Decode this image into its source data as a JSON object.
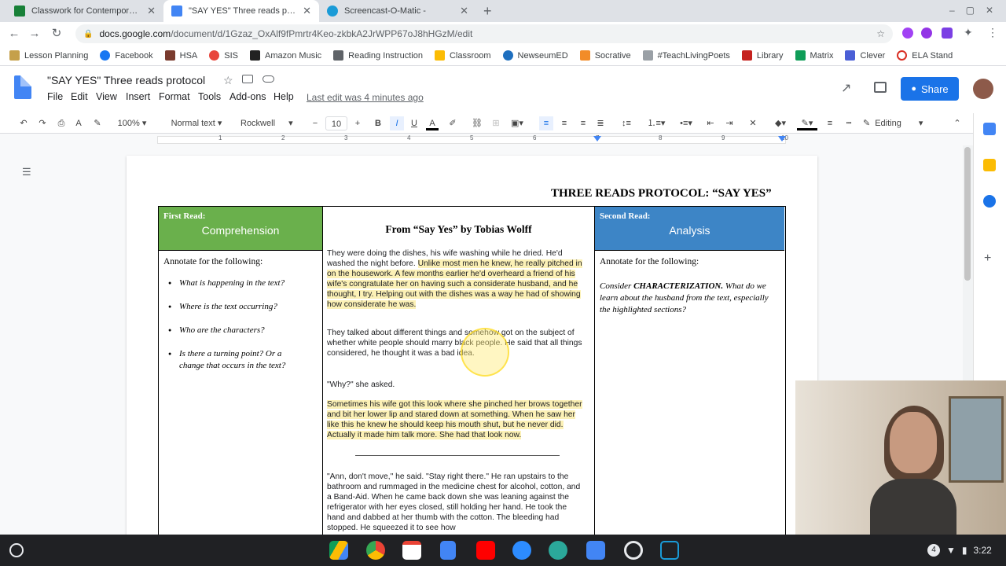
{
  "browser": {
    "tabs": [
      {
        "title": "Classwork for Contemporary Lite",
        "active": false
      },
      {
        "title": "\"SAY YES\" Three reads protocol",
        "active": true
      },
      {
        "title": "Screencast-O-Matic -",
        "active": false
      }
    ],
    "new_tab": "+",
    "url_host": "docs.google.com",
    "url_path": "/document/d/1Gzaz_OxAlf9fPmrtr4Keo-zkbkA2JrWPP67oJ8hHGzM/edit",
    "bookmarks": [
      "Lesson Planning",
      "Facebook",
      "HSA",
      "SIS",
      "Amazon Music",
      "Reading Instruction",
      "Classroom",
      "NewseumED",
      "Socrative",
      "#TeachLivingPoets",
      "Library",
      "Matrix",
      "Clever",
      "ELA Stand"
    ]
  },
  "docs": {
    "title": "\"SAY YES\" Three reads protocol",
    "menus": [
      "File",
      "Edit",
      "View",
      "Insert",
      "Format",
      "Tools",
      "Add-ons",
      "Help"
    ],
    "last_edit": "Last edit was 4 minutes ago",
    "share": "Share"
  },
  "toolbar": {
    "zoom": "100%",
    "style": "Normal text",
    "font": "Rockwell",
    "size": "10",
    "mode": "Editing"
  },
  "ruler_numbers": [
    "1",
    "2",
    "3",
    "4",
    "5",
    "6",
    "7",
    "8",
    "9",
    "10"
  ],
  "document": {
    "heading": "THREE READS PROTOCOL: “SAY YES”",
    "col1": {
      "small": "First Read:",
      "big": "Comprehension",
      "annotate": "Annotate for the following:",
      "bullets": [
        "What is happening in the text?",
        "Where is the text occurring?",
        "Who are the characters?",
        "Is there a turning point? Or a change that occurs in the text?"
      ]
    },
    "col2": {
      "title": "From “Say Yes” by Tobias Wolff",
      "p1_plain": "They were doing the dishes, his wife washing while he dried. He'd washed the night before. ",
      "p1_hl": "Unlike most men he knew, he really pitched in on the housework. A few months earlier he'd overheard a friend of his wife's congratulate her on having such a considerate husband, and he thought, I try.  Helping out with the dishes was a way he had of showing how considerate he was.",
      "p2": "They talked about different things and somehow got on the subject of whether white people should marry black people. He said that all things considered, he thought it was a bad idea.",
      "p3": "\"Why?\" she asked.",
      "p4": "Sometimes his wife got this look where she pinched her brows together and bit her lower lip and stared down at something. When he saw her like this he knew he should keep his mouth shut, but he never did. Actually it made him talk more. She had that look now.",
      "p5": "\"Ann, don't move,\" he said. \"Stay right there.\" He ran upstairs to the bathroom and rummaged in  the medicine chest for alcohol, cotton, and a Band-Aid. When he came back down she was leaning against the refrigerator with her eyes closed, still holding her hand. He took the hand and  dabbed at her thumb with the cotton. The bleeding had stopped. He squeezed it to see how"
    },
    "col3": {
      "small": "Second Read:",
      "big": "Analysis",
      "annotate": "Annotate for the following:",
      "consider_a": "Consider ",
      "consider_b": "CHARACTERIZATION.",
      "consider_c": " What do we learn about the husband from the text, especially the highlighted sections?"
    }
  },
  "shelf": {
    "badge": "4",
    "time": "3:22"
  },
  "colors": {
    "green": "#6ab04c",
    "blue": "#3d85c6",
    "highlight": "#fcf1b6",
    "share": "#1a73e8"
  }
}
